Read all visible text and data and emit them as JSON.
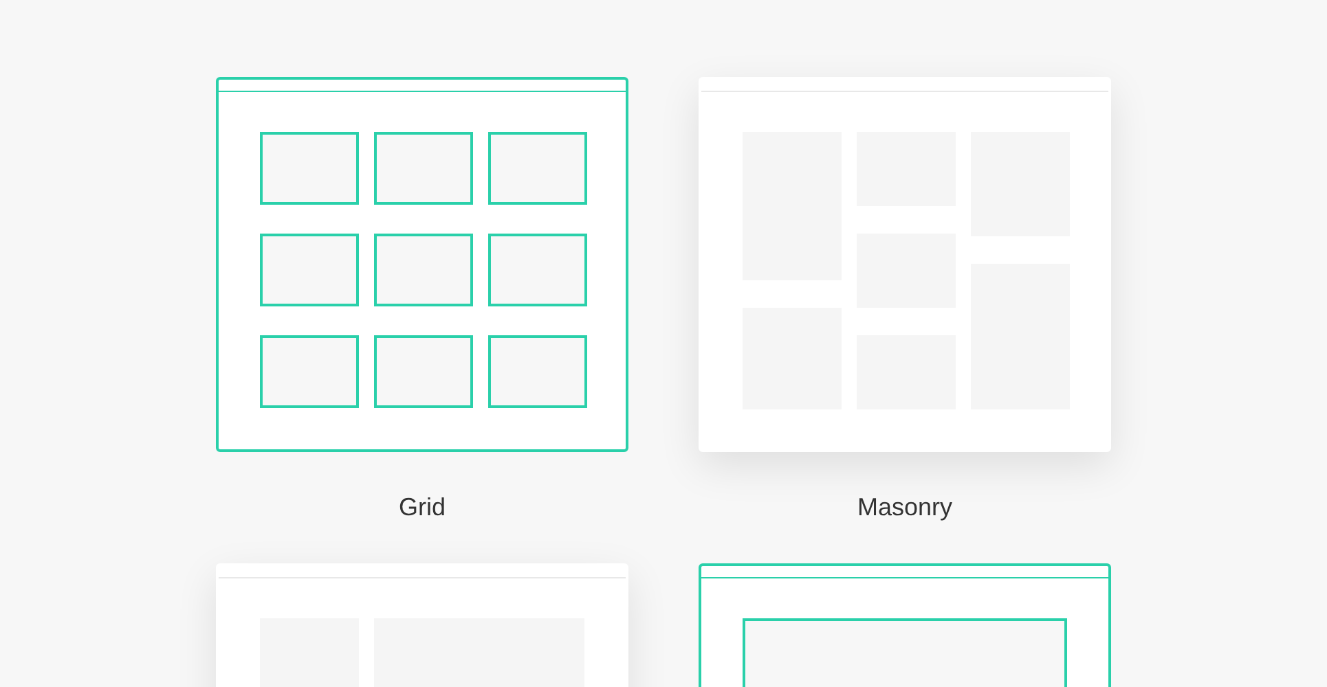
{
  "layouts": [
    {
      "kind": "grid",
      "label": "Grid",
      "selected": true
    },
    {
      "kind": "masonry",
      "label": "Masonry",
      "selected": false
    },
    {
      "kind": "sidebar",
      "selected": false
    },
    {
      "kind": "single",
      "selected": true
    }
  ]
}
